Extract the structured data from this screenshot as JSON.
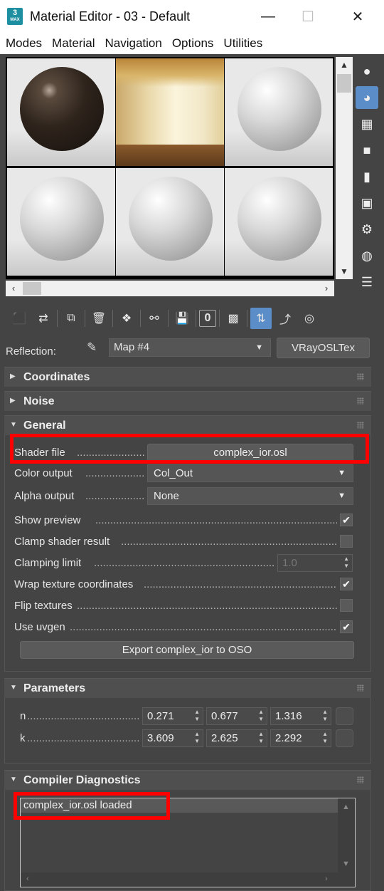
{
  "window": {
    "icon_text": "3",
    "icon_sub": "MAX",
    "title": "Material Editor - 03 - Default",
    "minimize": "—",
    "maximize": "☐",
    "close": "✕"
  },
  "menu": [
    "Modes",
    "Material",
    "Navigation",
    "Options",
    "Utilities"
  ],
  "toolbar": {
    "count_label": "0"
  },
  "reflection": {
    "label": "Reflection:",
    "map_name": "Map #4",
    "map_type": "VRayOSLTex"
  },
  "rollouts": {
    "coordinates": "Coordinates",
    "noise": "Noise",
    "general": "General",
    "parameters": "Parameters",
    "compiler": "Compiler Diagnostics"
  },
  "general": {
    "shader_file_label": "Shader file",
    "shader_file_value": "complex_ior.osl",
    "color_output_label": "Color output",
    "color_output_value": "Col_Out",
    "alpha_output_label": "Alpha output",
    "alpha_output_value": "None",
    "show_preview_label": "Show preview",
    "show_preview": true,
    "clamp_label": "Clamp shader result",
    "clamp": false,
    "clamp_limit_label": "Clamping limit",
    "clamp_limit_value": "1.0",
    "wrap_label": "Wrap texture coordinates",
    "wrap": true,
    "flip_label": "Flip textures",
    "flip": false,
    "uvgen_label": "Use uvgen",
    "uvgen": true,
    "export_button": "Export complex_ior to OSO"
  },
  "parameters": {
    "n_label": "n",
    "n_values": [
      "0.271",
      "0.677",
      "1.316"
    ],
    "k_label": "k",
    "k_values": [
      "3.609",
      "2.625",
      "2.292"
    ]
  },
  "diagnostics": {
    "message": "complex_ior.osl loaded"
  },
  "colors": {
    "highlight": "#ff0000",
    "active_tool": "#5b8ec8",
    "panel_bg": "#444444"
  }
}
